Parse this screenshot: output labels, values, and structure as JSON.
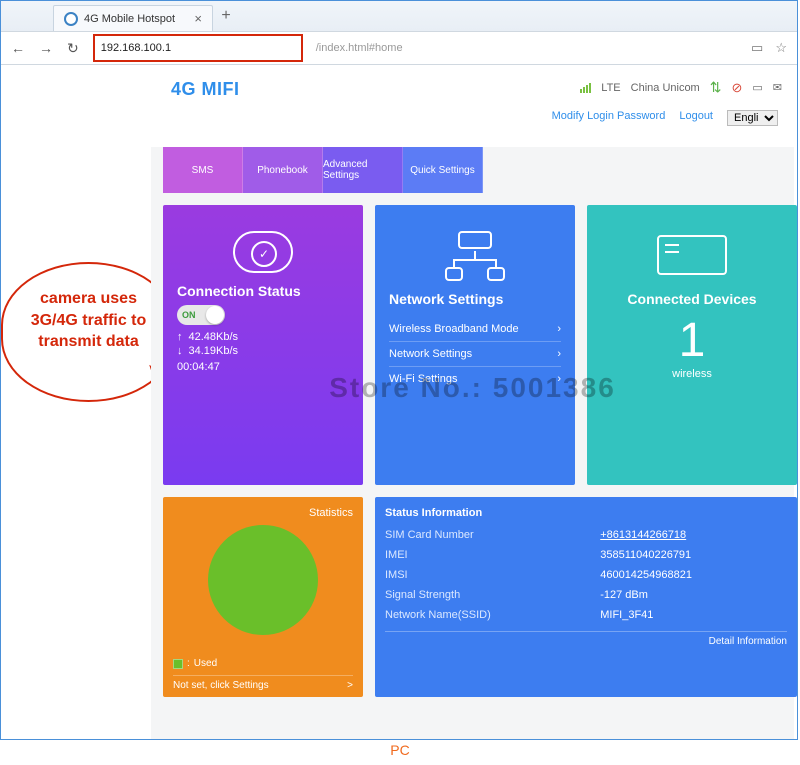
{
  "browser": {
    "tab_title": "4G Mobile Hotspot",
    "url_host": "192.168.100.1",
    "url_rest": "/index.html#home"
  },
  "annotation": {
    "text": "camera uses 3G/4G traffic to transmit data",
    "caption": "PC"
  },
  "watermark": "Store No.: 5001386",
  "header": {
    "brand": "4G MIFI",
    "network_mode": "LTE",
    "carrier": "China Unicom",
    "links": {
      "modify_pw": "Modify Login Password",
      "logout": "Logout"
    },
    "lang": "Engli"
  },
  "menu": {
    "sms": "SMS",
    "phonebook": "Phonebook",
    "advanced": "Advanced Settings",
    "quick": "Quick Settings"
  },
  "conn": {
    "title": "Connection Status",
    "toggle": "ON",
    "up": "42.48Kb/s",
    "down": "34.19Kb/s",
    "duration": "00:04:47"
  },
  "net": {
    "title": "Network Settings",
    "items": [
      "Wireless Broadband Mode",
      "Network Settings",
      "Wi-Fi Settings"
    ]
  },
  "dev": {
    "title": "Connected Devices",
    "count": "1",
    "sub": "wireless"
  },
  "stat": {
    "title": "Statistics",
    "legend": "Used",
    "footer": "Not set, click Settings",
    "chev": ">"
  },
  "info": {
    "title": "Status Information",
    "rows": [
      {
        "k": "SIM Card Number",
        "v": "+8613144266718",
        "u": true
      },
      {
        "k": "IMEI",
        "v": "358511040226791"
      },
      {
        "k": "IMSI",
        "v": "460014254968821"
      },
      {
        "k": "Signal Strength",
        "v": "-127 dBm"
      },
      {
        "k": "Network Name(SSID)",
        "v": "MIFI_3F41"
      }
    ],
    "detail": "Detail Information"
  }
}
